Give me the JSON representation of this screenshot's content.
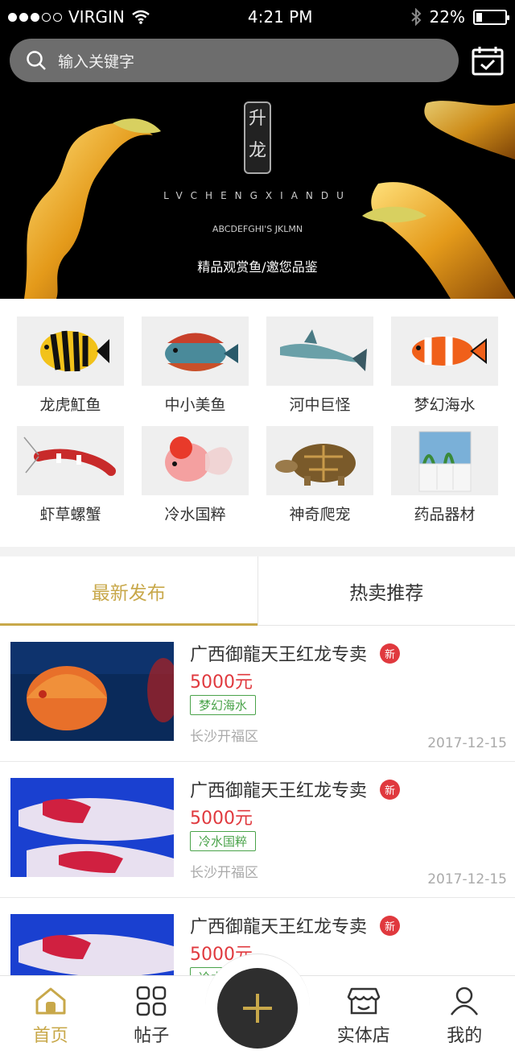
{
  "status_bar": {
    "carrier": "VIRGIN",
    "time": "4:21 PM",
    "battery": "22%",
    "battery_level": 0.22
  },
  "search": {
    "placeholder": "输入关键字"
  },
  "banner": {
    "seal_text": "升龙",
    "latin_text": "LVCHENGXIANDU",
    "brand_text": "ABCDEFGHI'S JKLMN",
    "caption": "精品观赏鱼/邀您品鉴"
  },
  "categories": [
    {
      "label": "龙虎魟鱼",
      "icon": "tiger-fish"
    },
    {
      "label": "中小美鱼",
      "icon": "cichlid-fish"
    },
    {
      "label": "河中巨怪",
      "icon": "catfish"
    },
    {
      "label": "梦幻海水",
      "icon": "clownfish"
    },
    {
      "label": "虾草螺蟹",
      "icon": "shrimp"
    },
    {
      "label": "冷水国粹",
      "icon": "goldfish"
    },
    {
      "label": "神奇爬宠",
      "icon": "tortoise"
    },
    {
      "label": "药品器材",
      "icon": "aquarium-tank"
    }
  ],
  "tabs": [
    {
      "label": "最新发布",
      "active": true
    },
    {
      "label": "热卖推荐",
      "active": false
    }
  ],
  "feed": [
    {
      "title": "广西御龍天王红龙专卖",
      "badge": "新",
      "price": "5000元",
      "tag": "梦幻海水",
      "location": "长沙开福区",
      "date": "2017-12-15",
      "image": "discus-fish"
    },
    {
      "title": "广西御龍天王红龙专卖",
      "badge": "新",
      "price": "5000元",
      "tag": "冷水国粹",
      "location": "长沙开福区",
      "date": "2017-12-15",
      "image": "koi-fish"
    },
    {
      "title": "广西御龍天王红龙专卖",
      "badge": "新",
      "price": "5000元",
      "tag": "冷水国粹",
      "location": "",
      "date": "",
      "image": "koi-fish"
    }
  ],
  "nav": {
    "home": "首页",
    "posts": "帖子",
    "store": "实体店",
    "mine": "我的"
  },
  "colors": {
    "accent": "#c8a84a",
    "price": "#e0393e",
    "tag": "#4aa34a"
  }
}
